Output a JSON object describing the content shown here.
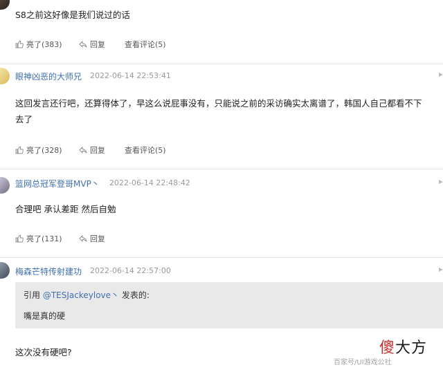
{
  "comments": [
    {
      "text": "S8之前这好像是我们说过的话",
      "actions": {
        "like": "亮了(383)",
        "reply": "回复",
        "view": "查看评论(5)"
      }
    },
    {
      "username": "眼神凶恶的大师兄",
      "time": "2022-06-14 22:53:41",
      "text": "这回发言还行吧，还算得体了，早这么说屁事没有，只能说之前的采访确实太离谱了，韩国人自己都看不下去了",
      "actions": {
        "like": "亮了(328)",
        "reply": "回复",
        "view": "查看评论(5)"
      }
    },
    {
      "username": "篮网总冠军登哥MVP丶",
      "time": "2022-06-14 22:48:42",
      "text": "合理吧 承认差距 然后自勉",
      "actions": {
        "like": "亮了(131)",
        "reply": "回复"
      }
    },
    {
      "username": "梅森芒特传射建功",
      "time": "2022-06-14 22:57:00",
      "quote": {
        "prefix": "引用",
        "mention": "@TESJackeylove丶",
        "suffix": "发表的:",
        "text": "嘴是真的硬"
      },
      "text": "这次没有硬吧?"
    }
  ],
  "watermark": {
    "logo_main": "傻",
    "logo_rest": "大方",
    "source": "百家号/UI游戏公社"
  },
  "colors": {
    "username": "#3e6fb0",
    "quote_bg": "#e9e9e9",
    "separator": "#e6e6e6"
  }
}
